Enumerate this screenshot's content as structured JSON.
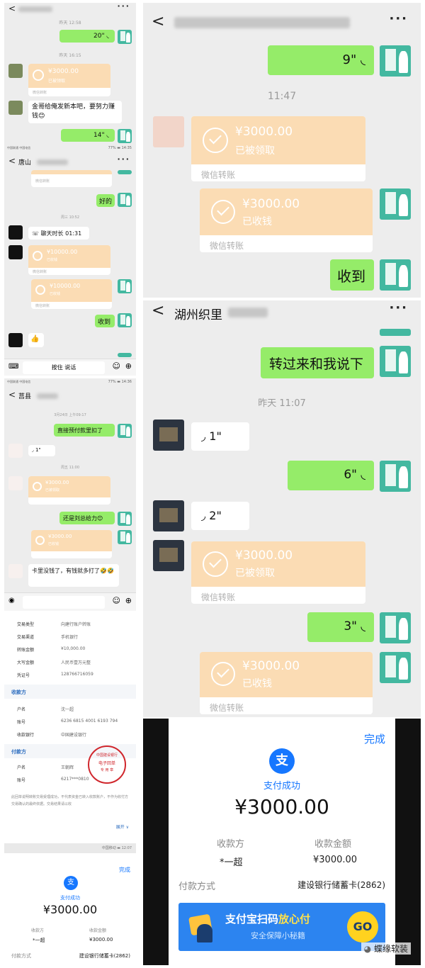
{
  "chats": {
    "c1": {
      "time1": "昨天 12:58",
      "voice1": "20\"",
      "time2": "昨天 16:15",
      "transfer1_amount": "¥3000.00",
      "transfer1_status": "已被领取",
      "transfer1_label": "微信转账",
      "msg1": "金哥给俺发新本吧，要努力赚钱😊",
      "voice2": "14\""
    },
    "c2": {
      "status_left": "中国联通 中国电信",
      "status_right": "77% ▬ 14:35",
      "title": "唐山",
      "transfer_label": "微信转账",
      "msg_ok": "好的",
      "time1": "周三 10:52",
      "call": "聊天时长 01:31",
      "transfer1_amount": "¥10000.00",
      "transfer1_status": "已收钱",
      "transfer2_amount": "¥10000.00",
      "transfer2_status": "已收钱",
      "msg_received": "收到",
      "emoji": "👍",
      "press_talk": "按住 说话"
    },
    "c3": {
      "status_left": "中国联通 中国电信",
      "status_right": "77% ▬ 14:36",
      "title": "莒县",
      "time1": "3月24日 上午09:17",
      "msg1": "直接预付款里扣了",
      "voice1": "1\"",
      "time2": "周五 11:00",
      "transfer1_amount": "¥3000.00",
      "transfer1_status": "已被领取",
      "msg2": "还是刘总给力😊",
      "transfer2_amount": "¥3000.00",
      "transfer2_status": "已收钱",
      "msg3": "卡里没钱了，有钱就多打了🤣🤣"
    },
    "c4": {
      "voice1": "9\"",
      "time1": "11:47",
      "transfer1_amount": "¥3000.00",
      "transfer1_status": "已被领取",
      "transfer_label": "微信转账",
      "transfer2_amount": "¥3000.00",
      "transfer2_status": "已收钱",
      "msg_received": "收到"
    },
    "c5": {
      "title": "湖州织里",
      "msg1": "转过来和我说下",
      "time1": "昨天 11:07",
      "voice1": "1\"",
      "voice2": "6\"",
      "voice3": "2\"",
      "transfer1_amount": "¥3000.00",
      "transfer1_status": "已被领取",
      "transfer_label": "微信转账",
      "voice4": "3\"",
      "transfer2_amount": "¥3000.00",
      "transfer2_status": "已收钱"
    }
  },
  "bank": {
    "rows1": [
      {
        "k": "交易类型",
        "v": "向建行账户转账"
      },
      {
        "k": "交易渠道",
        "v": "手机银行"
      },
      {
        "k": "转账金额",
        "v": "¥10,000.00"
      },
      {
        "k": "大写金额",
        "v": "人民币壹万元整"
      },
      {
        "k": "凭证号",
        "v": "128766716059"
      }
    ],
    "payee_title": "收款方",
    "rows2": [
      {
        "k": "户名",
        "v": "沈一超"
      },
      {
        "k": "账号",
        "v": "6236 6815 4001 6193 794"
      },
      {
        "k": "收款银行",
        "v": "中国建设银行"
      }
    ],
    "payer_title": "付款方",
    "rows3": [
      {
        "k": "户名",
        "v": "王朝辉"
      },
      {
        "k": "账号",
        "v": "6217***0810"
      }
    ],
    "stamp_top": "中国建设银行",
    "stamp_mid": "电子回单",
    "stamp_bot": "专 用 章",
    "note": "此回单说明转账交易受理成功，不代表资金已转入收款账户，不作为收付方交易确认的最终依据。交易结果请以收",
    "expand": "展开 ∨"
  },
  "alipay_small": {
    "statusbar": "中国移动 ▬ 12:07",
    "done": "完成",
    "icon_glyph": "支",
    "success": "支付成功",
    "amount": "¥3000.00",
    "payee_label": "收款方",
    "amount_label": "收款金额",
    "payee": "*一超",
    "amount2": "¥3000.00",
    "method_label": "付款方式",
    "method": "建设银行储蓄卡(2862)"
  },
  "alipay_big": {
    "done": "完成",
    "icon_glyph": "支",
    "success": "支付成功",
    "amount": "¥3000.00",
    "payee_label": "收款方",
    "amount_label": "收款金额",
    "payee": "*一超",
    "amount2": "¥3000.00",
    "method_label": "付款方式",
    "method": "建设银行储蓄卡(2862)",
    "banner_main_a": "支付宝扫码",
    "banner_main_b": "放心付",
    "banner_sub": "安全保障小秘籍",
    "banner_go": "GO"
  },
  "watermark": "蝶缘软装",
  "colors": {
    "wechat_green": "#95ec69",
    "transfer_orange": "#fbdcb4",
    "alipay_blue": "#1677ff",
    "bank_blue": "#2f6fc0",
    "stamp_red": "#d0262c"
  }
}
